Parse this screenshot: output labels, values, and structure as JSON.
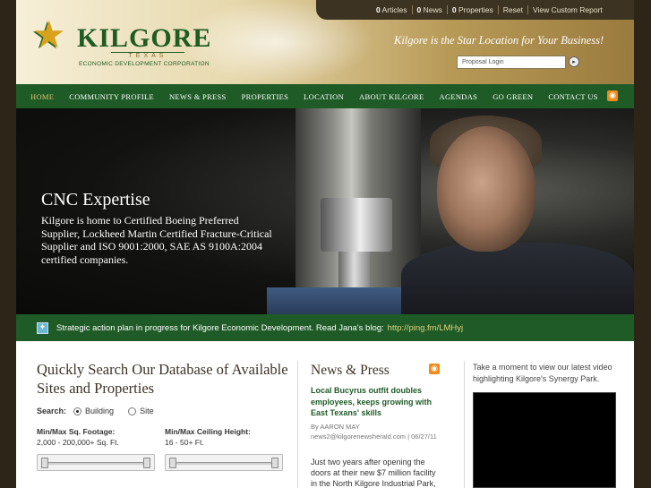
{
  "header": {
    "logo_name": "KILGORE",
    "logo_state": "TEXAS",
    "logo_sub": "ECONOMIC DEVELOPMENT CORPORATION",
    "tagline": "Kilgore is the Star Location for Your Business!",
    "login_placeholder": "Proposal Login",
    "login_go": "▸"
  },
  "topbar": {
    "articles_count": "0",
    "articles_label": "Articles",
    "news_count": "0",
    "news_label": "News",
    "properties_count": "0",
    "properties_label": "Properties",
    "reset": "Reset",
    "report": "View Custom Report"
  },
  "nav": {
    "items": [
      "HOME",
      "COMMUNITY PROFILE",
      "NEWS & PRESS",
      "PROPERTIES",
      "LOCATION",
      "ABOUT KILGORE",
      "AGENDAS",
      "GO GREEN",
      "CONTACT US"
    ],
    "active": "HOME"
  },
  "hero": {
    "title": "CNC Expertise",
    "description": "Kilgore is home to Certified Boeing Preferred Supplier, Lockheed Martin Certified Fracture-Critical Supplier and ISO 9001:2000, SAE AS 9100A:2004 certified companies."
  },
  "banner": {
    "text": "Strategic action plan in progress for Kilgore Economic Development. Read Jana's blog:",
    "link": "http://ping.fm/LMHyj"
  },
  "search": {
    "heading": "Quickly Search Our Database of Available Sites and Properties",
    "label": "Search:",
    "option_building": "Building",
    "option_site": "Site",
    "selected": "Building",
    "footage_label": "Min/Max Sq. Footage:",
    "footage_value": "2,000 - 200,000+ Sq. Ft.",
    "ceiling_label": "Min/Max Ceiling Height:",
    "ceiling_value": "16 - 50+ Ft."
  },
  "news": {
    "heading": "News & Press",
    "title": "Local Bucyrus outfit doubles employees, keeps growing with East Texans' skills",
    "author": "By AARON MAY",
    "source": "news2@kilgorenewsherald.com | 06/27/11",
    "body": "Just two years after opening the doors at their new $7 million facility in the North Kilgore Industrial Park,"
  },
  "video": {
    "intro": "Take a moment to view our latest video highlighting Kilgore's Synergy Park."
  },
  "icons": {
    "rss": "rss-icon",
    "star": "star-icon",
    "banner": "twitter-icon"
  },
  "colors": {
    "nav_green": "#1f5b27",
    "accent_gold": "#e3c36b",
    "rss_orange": "#f28a1a"
  }
}
